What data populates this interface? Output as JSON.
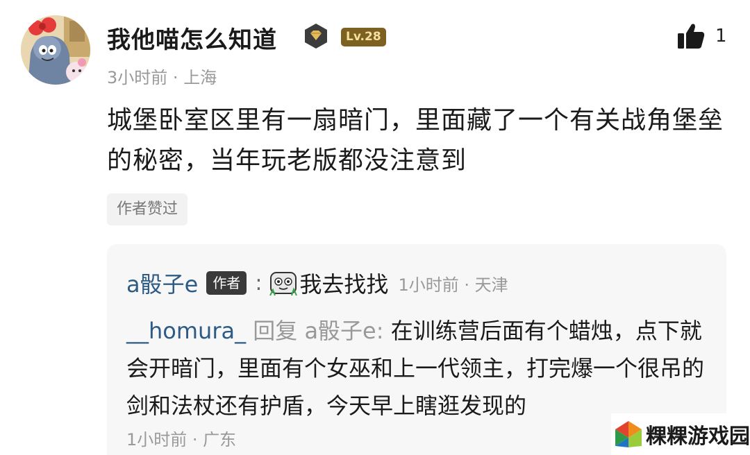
{
  "comment": {
    "username": "我他喵怎么知道",
    "level": "Lv.28",
    "like_count": "1",
    "time": "3小时前",
    "location": "上海",
    "meta_separator": "·",
    "content": "城堡卧室区里有一扇暗门，里面藏了一个有关战角堡垒的秘密，当年玩老版都没注意到",
    "author_liked": "作者赞过"
  },
  "replies": [
    {
      "username": "a骰子e",
      "tag": "作者",
      "colon": ":",
      "emoji": "sticker-emoji",
      "text": "我去找找",
      "time": "1小时前 · 天津"
    },
    {
      "username": "__homura_",
      "reply_word": "回复",
      "reply_to": "a骰子e:",
      "text": "在训练营后面有个蜡烛，点下就会开暗门，里面有个女巫和上一代领主，打完爆一个很吊的剑和法杖还有护盾，今天早上瞎逛发现的",
      "time": "1小时前 · 广东"
    }
  ],
  "watermark": {
    "text": "粿粿游戏园"
  },
  "colors": {
    "level_badge": "#7c6121",
    "reply_name": "#2d5b85",
    "author_tag": "#3a3a3a",
    "muted_text": "#999999"
  },
  "icons": [
    "avatar-image",
    "diamond-badge-icon",
    "thumbs-up-icon",
    "sticker-emoji",
    "watermark-logo-icon"
  ]
}
